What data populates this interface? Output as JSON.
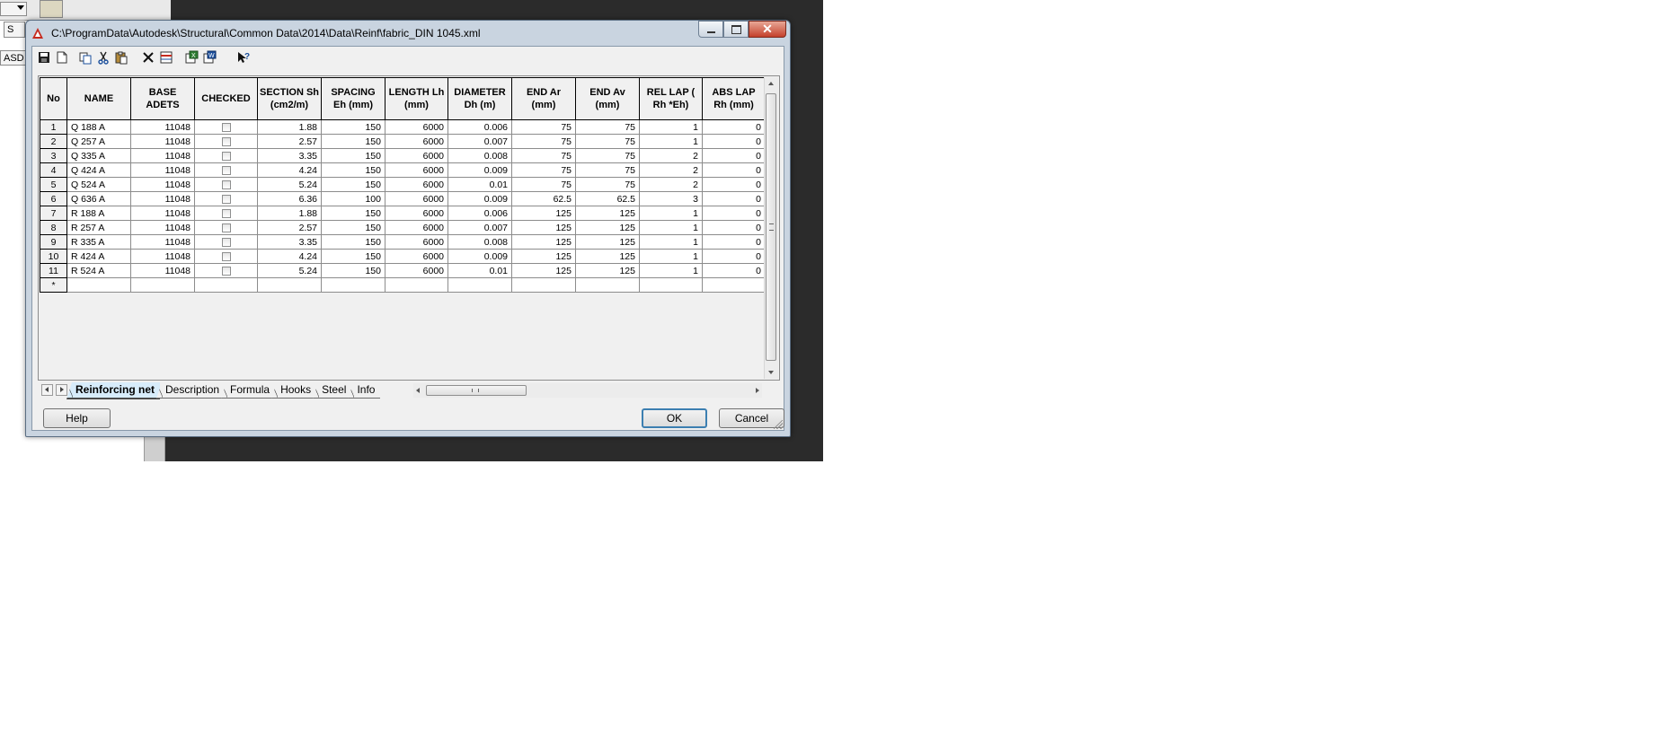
{
  "background": {
    "dropdown_value": "",
    "small_button_label": "S",
    "asd_label": "ASD"
  },
  "dialog": {
    "title": "C:\\ProgramData\\Autodesk\\Structural\\Common Data\\2014\\Data\\Reinf\\fabric_DIN 1045.xml",
    "icons": {
      "app": "autodesk-app-icon",
      "save": "save-icon",
      "new": "new-document-icon",
      "copy": "copy-icon",
      "cut": "cut-icon",
      "paste": "paste-icon",
      "delete": "delete-icon",
      "insert_row": "insert-row-icon",
      "export_excel": "export-excel-icon",
      "export_word": "export-word-icon",
      "context_help": "context-help-icon"
    },
    "colors": {
      "titlebar": "#c9d4e0",
      "active_tab": "#d7ecfb",
      "close_button": "#c4402b",
      "ok_border": "#3c7fb1"
    }
  },
  "grid": {
    "columns": [
      {
        "key": "no",
        "label": "No"
      },
      {
        "key": "name",
        "label": "NAME"
      },
      {
        "key": "base",
        "label": "BASE ADETS"
      },
      {
        "key": "checked",
        "label": "CHECKED"
      },
      {
        "key": "section",
        "label": "SECTION Sh (cm2/m)"
      },
      {
        "key": "spacing",
        "label": "SPACING Eh (mm)"
      },
      {
        "key": "length",
        "label": "LENGTH Lh (mm)"
      },
      {
        "key": "diameter",
        "label": "DIAMETER Dh (m)"
      },
      {
        "key": "end_ar",
        "label": "END Ar (mm)"
      },
      {
        "key": "end_av",
        "label": "END Av (mm)"
      },
      {
        "key": "rel_lap",
        "label": "REL LAP ( Rh *Eh)"
      },
      {
        "key": "abs_lap",
        "label": "ABS LAP Rh (mm)"
      }
    ],
    "rows": [
      {
        "no": "1",
        "name": "Q 188 A",
        "base": "11048",
        "checked": false,
        "section": "1.88",
        "spacing": "150",
        "length": "6000",
        "diameter": "0.006",
        "end_ar": "75",
        "end_av": "75",
        "rel_lap": "1",
        "abs_lap": "0"
      },
      {
        "no": "2",
        "name": "Q 257 A",
        "base": "11048",
        "checked": false,
        "section": "2.57",
        "spacing": "150",
        "length": "6000",
        "diameter": "0.007",
        "end_ar": "75",
        "end_av": "75",
        "rel_lap": "1",
        "abs_lap": "0"
      },
      {
        "no": "3",
        "name": "Q 335 A",
        "base": "11048",
        "checked": false,
        "section": "3.35",
        "spacing": "150",
        "length": "6000",
        "diameter": "0.008",
        "end_ar": "75",
        "end_av": "75",
        "rel_lap": "2",
        "abs_lap": "0"
      },
      {
        "no": "4",
        "name": "Q 424 A",
        "base": "11048",
        "checked": false,
        "section": "4.24",
        "spacing": "150",
        "length": "6000",
        "diameter": "0.009",
        "end_ar": "75",
        "end_av": "75",
        "rel_lap": "2",
        "abs_lap": "0"
      },
      {
        "no": "5",
        "name": "Q 524 A",
        "base": "11048",
        "checked": false,
        "section": "5.24",
        "spacing": "150",
        "length": "6000",
        "diameter": "0.01",
        "end_ar": "75",
        "end_av": "75",
        "rel_lap": "2",
        "abs_lap": "0"
      },
      {
        "no": "6",
        "name": "Q 636 A",
        "base": "11048",
        "checked": false,
        "section": "6.36",
        "spacing": "100",
        "length": "6000",
        "diameter": "0.009",
        "end_ar": "62.5",
        "end_av": "62.5",
        "rel_lap": "3",
        "abs_lap": "0"
      },
      {
        "no": "7",
        "name": "R 188 A",
        "base": "11048",
        "checked": false,
        "section": "1.88",
        "spacing": "150",
        "length": "6000",
        "diameter": "0.006",
        "end_ar": "125",
        "end_av": "125",
        "rel_lap": "1",
        "abs_lap": "0"
      },
      {
        "no": "8",
        "name": "R 257 A",
        "base": "11048",
        "checked": false,
        "section": "2.57",
        "spacing": "150",
        "length": "6000",
        "diameter": "0.007",
        "end_ar": "125",
        "end_av": "125",
        "rel_lap": "1",
        "abs_lap": "0"
      },
      {
        "no": "9",
        "name": "R 335 A",
        "base": "11048",
        "checked": false,
        "section": "3.35",
        "spacing": "150",
        "length": "6000",
        "diameter": "0.008",
        "end_ar": "125",
        "end_av": "125",
        "rel_lap": "1",
        "abs_lap": "0"
      },
      {
        "no": "10",
        "name": "R 424 A",
        "base": "11048",
        "checked": false,
        "section": "4.24",
        "spacing": "150",
        "length": "6000",
        "diameter": "0.009",
        "end_ar": "125",
        "end_av": "125",
        "rel_lap": "1",
        "abs_lap": "0"
      },
      {
        "no": "11",
        "name": "R 524 A",
        "base": "11048",
        "checked": false,
        "section": "5.24",
        "spacing": "150",
        "length": "6000",
        "diameter": "0.01",
        "end_ar": "125",
        "end_av": "125",
        "rel_lap": "1",
        "abs_lap": "0"
      }
    ],
    "new_row_marker": "*"
  },
  "tabs": [
    {
      "label": "Reinforcing net",
      "active": true
    },
    {
      "label": "Description",
      "active": false
    },
    {
      "label": "Formula",
      "active": false
    },
    {
      "label": "Hooks",
      "active": false
    },
    {
      "label": "Steel",
      "active": false
    },
    {
      "label": "Info",
      "active": false
    }
  ],
  "buttons": {
    "help": "Help",
    "ok": "OK",
    "cancel": "Cancel"
  }
}
